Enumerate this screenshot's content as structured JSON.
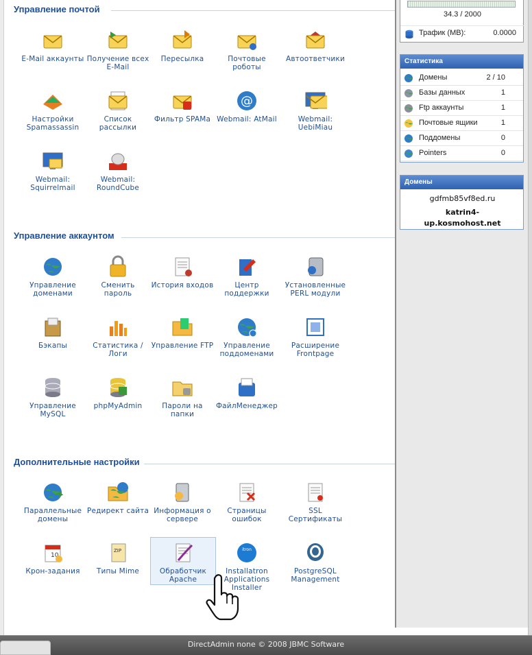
{
  "top_box": {
    "usage_text": "34.3 / 2000",
    "traffic_label": "Трафик (MB):",
    "traffic_value": "0.0000"
  },
  "stats": {
    "title": "Статистика",
    "rows": [
      {
        "label": "Домены",
        "value": "2 / 10",
        "icon": "globe-icon"
      },
      {
        "label": "Базы данных",
        "value": "1",
        "icon": "database-icon"
      },
      {
        "label": "Ftp аккаунты",
        "value": "1",
        "icon": "ftp-icon"
      },
      {
        "label": "Почтовые ящики",
        "value": "1",
        "icon": "mailbox-icon"
      },
      {
        "label": "Поддомены",
        "value": "0",
        "icon": "subdomain-icon"
      },
      {
        "label": "Pointers",
        "value": "0",
        "icon": "pointer-icon"
      }
    ]
  },
  "domains": {
    "title": "Домены",
    "items": [
      "gdfmb85vf8ed.ru",
      "katrin4-up.kosmohost.net"
    ]
  },
  "sections": [
    {
      "title": "Управление почтой",
      "items": [
        {
          "label": "E-Mail аккаунты",
          "icon": "email-accounts-icon"
        },
        {
          "label": "Получение всех E-Mail",
          "icon": "catch-all-email-icon"
        },
        {
          "label": "Пересылка",
          "icon": "forwarding-icon"
        },
        {
          "label": "Почтовые роботы",
          "icon": "mail-robots-icon"
        },
        {
          "label": "Автоответчики",
          "icon": "autoresponder-icon"
        },
        {
          "label": "Настройки Spamassassin",
          "icon": "spamassassin-icon"
        },
        {
          "label": "Список рассылки",
          "icon": "mailing-list-icon"
        },
        {
          "label": "Фильтр SPAMа",
          "icon": "spam-filter-icon"
        },
        {
          "label": "Webmail: AtMail",
          "icon": "atmail-icon"
        },
        {
          "label": "Webmail: UebiMiau",
          "icon": "uebimiau-icon"
        },
        {
          "label": "Webmail: Squirrelmail",
          "icon": "squirrelmail-icon"
        },
        {
          "label": "Webmail: RoundCube",
          "icon": "roundcube-icon"
        }
      ]
    },
    {
      "title": "Управление аккаунтом",
      "items": [
        {
          "label": "Управление доменами",
          "icon": "domains-icon"
        },
        {
          "label": "Сменить пароль",
          "icon": "padlock-icon"
        },
        {
          "label": "История входов",
          "icon": "login-history-icon"
        },
        {
          "label": "Центр поддержки",
          "icon": "support-center-icon"
        },
        {
          "label": "Установленные PERL модули",
          "icon": "perl-modules-icon"
        },
        {
          "label": "Бэкапы",
          "icon": "backups-icon"
        },
        {
          "label": "Статистика / Логи",
          "icon": "statistics-icon"
        },
        {
          "label": "Управление FTP",
          "icon": "ftp-management-icon"
        },
        {
          "label": "Управление поддоменами",
          "icon": "subdomains-icon"
        },
        {
          "label": "Расширение Frontpage",
          "icon": "frontpage-icon"
        },
        {
          "label": "Управление MySQL",
          "icon": "mysql-icon"
        },
        {
          "label": "phpMyAdmin",
          "icon": "phpmyadmin-icon"
        },
        {
          "label": "Пароли на папки",
          "icon": "folder-password-icon"
        },
        {
          "label": "ФайлМенеджер",
          "icon": "file-manager-icon"
        }
      ]
    },
    {
      "title": "Дополнительные настройки",
      "items": [
        {
          "label": "Параллельные домены",
          "icon": "parallel-domains-icon"
        },
        {
          "label": "Редирект сайта",
          "icon": "redirect-icon"
        },
        {
          "label": "Информация о сервере",
          "icon": "server-info-icon"
        },
        {
          "label": "Страницы ошибок",
          "icon": "error-pages-icon"
        },
        {
          "label": "SSL Сертификаты",
          "icon": "ssl-certificate-icon"
        },
        {
          "label": "Крон-задания",
          "icon": "cron-jobs-icon"
        },
        {
          "label": "Типы Mime",
          "icon": "mime-types-icon"
        },
        {
          "label": "Обработчик Apache",
          "icon": "apache-handler-icon"
        },
        {
          "label": "Installatron Applications Installer",
          "icon": "installatron-icon"
        },
        {
          "label": "PostgreSQL Management",
          "icon": "postgresql-icon"
        }
      ]
    }
  ],
  "footer": {
    "text": "DirectAdmin none © 2008 JBMC Software"
  }
}
